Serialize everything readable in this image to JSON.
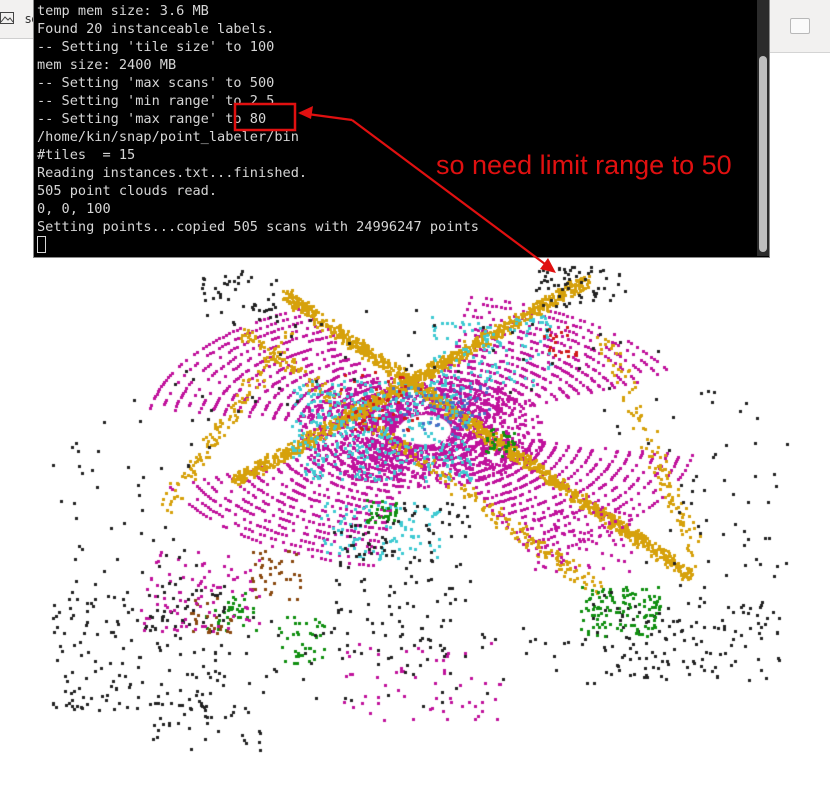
{
  "background_window": {
    "tab_label": "sc",
    "tab_icon": "image-icon"
  },
  "terminal": {
    "lines": [
      "temp mem size: 3.6 MB",
      "Found 20 instanceable labels.",
      "-- Setting 'tile size' to 100",
      "mem size: 2400 MB",
      "-- Setting 'max scans' to 500",
      "-- Setting 'min range' to 2.5",
      "-- Setting 'max range' to 80",
      "/home/kin/snap/point_labeler/bin",
      "#tiles  = 15",
      "Reading instances.txt...finished.",
      "505 point clouds read.",
      "0, 0, 100",
      "Setting points...copied 505 scans with 24996247 points"
    ],
    "highlight": "to 80"
  },
  "annotation": {
    "text": "so need limit range to 50",
    "color": "#e01010"
  },
  "point_cloud": {
    "label_colors": [
      "#c0129c",
      "#d6a10b",
      "#3fcad2",
      "#222222",
      "#118f11",
      "#d11a1a",
      "#4a6fc6",
      "#8a4a10"
    ]
  }
}
